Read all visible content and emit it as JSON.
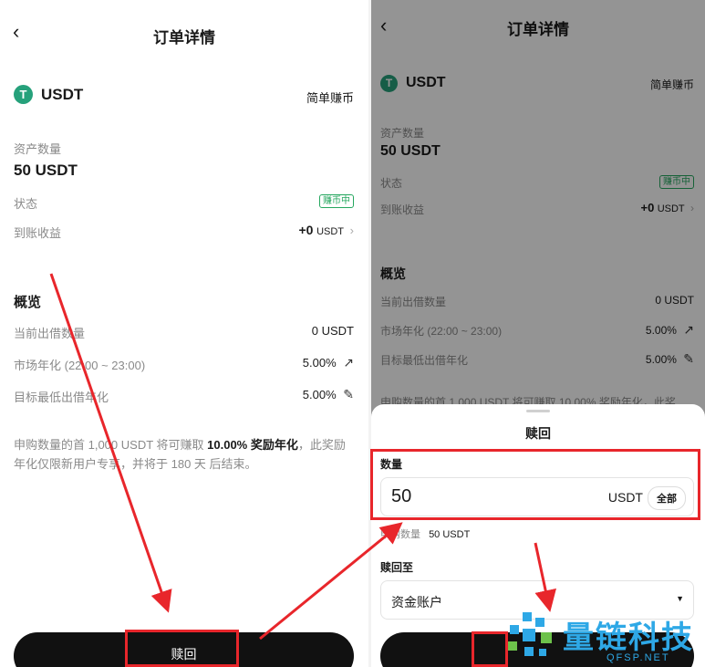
{
  "left": {
    "title": "订单详情",
    "coin": {
      "symbol": "USDT",
      "product": "简单赚币"
    },
    "asset_label": "资产数量",
    "asset_value": "50 USDT",
    "status_label": "状态",
    "status_badge": "赚币中",
    "earnings_label": "到账收益",
    "earnings_value": "+0",
    "earnings_unit": "USDT",
    "overview_title": "概览",
    "rows": [
      {
        "label": "当前出借数量",
        "value": "0 USDT"
      },
      {
        "label": "市场年化 (22:00 ~ 23:00)",
        "value": "5.00%"
      },
      {
        "label": "目标最低出借年化",
        "value": "5.00%"
      }
    ],
    "note": {
      "part1": "申购数量的首 1,000 USDT 将可赚取 ",
      "highlight": "10.00% 奖励年化",
      "part2": "，此奖励年化仅限新用户专享，并将于 180 天 后结束。"
    },
    "redeem_button": "赎回"
  },
  "right": {
    "title": "订单详情",
    "coin": {
      "symbol": "USDT",
      "product": "简单赚币"
    },
    "asset_label": "资产数量",
    "asset_value": "50 USDT",
    "status_label": "状态",
    "status_badge": "赚币中",
    "earnings_label": "到账收益",
    "earnings_value": "+0",
    "earnings_unit": "USDT",
    "overview_title": "概览",
    "rows": [
      {
        "label": "当前出借数量",
        "value": "0 USDT"
      },
      {
        "label": "市场年化 (22:00 ~ 23:00)",
        "value": "5.00%"
      },
      {
        "label": "目标最低出借年化",
        "value": "5.00%"
      }
    ],
    "note_partial": "申购数量的首 1,000 USDT 将可赚取 10.00% 奖励年化，此奖",
    "sheet": {
      "title": "赎回",
      "qty_label": "数量",
      "qty_value": "50",
      "qty_unit": "USDT",
      "all_button": "全部",
      "subscribed_label": "申购数量",
      "subscribed_value": "50 USDT",
      "redeem_to_label": "赎回至",
      "account": "资金账户"
    }
  },
  "watermark": {
    "name": "量链科技",
    "domain": "QFSP.NET"
  },
  "colors": {
    "accent_green": "#25a75f",
    "coin_green": "#26a17b",
    "annotation_red": "#e8262b",
    "watermark_blue": "#2ea8e6"
  }
}
